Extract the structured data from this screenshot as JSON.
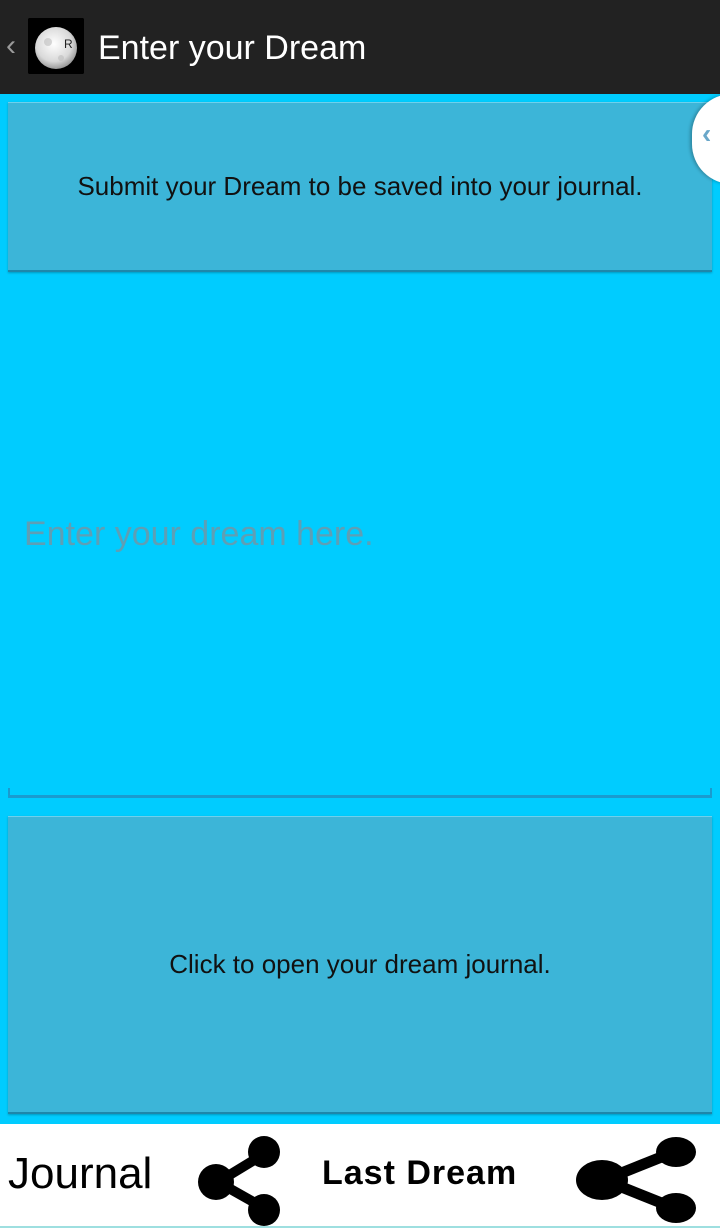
{
  "action_bar": {
    "title": "Enter your Dream",
    "up_icon": "chevron-left-icon",
    "app_icon": "moon-icon",
    "background": "#222222"
  },
  "main": {
    "background": "#00ccff",
    "submit_button_label": "Submit your Dream to be saved into your journal.",
    "dream_input_placeholder": "Enter your dream here.",
    "dream_input_value": "",
    "open_journal_button_label": "Click to open your dream journal.",
    "button_color": "#3cb5d8"
  },
  "drawer": {
    "handle_icon": "chevron-left-icon"
  },
  "bottom_bar": {
    "journal_label": "Journal",
    "journal_share_icon": "share-icon",
    "last_dream_label": "Last Dream",
    "last_dream_share_icon": "share-icon"
  }
}
